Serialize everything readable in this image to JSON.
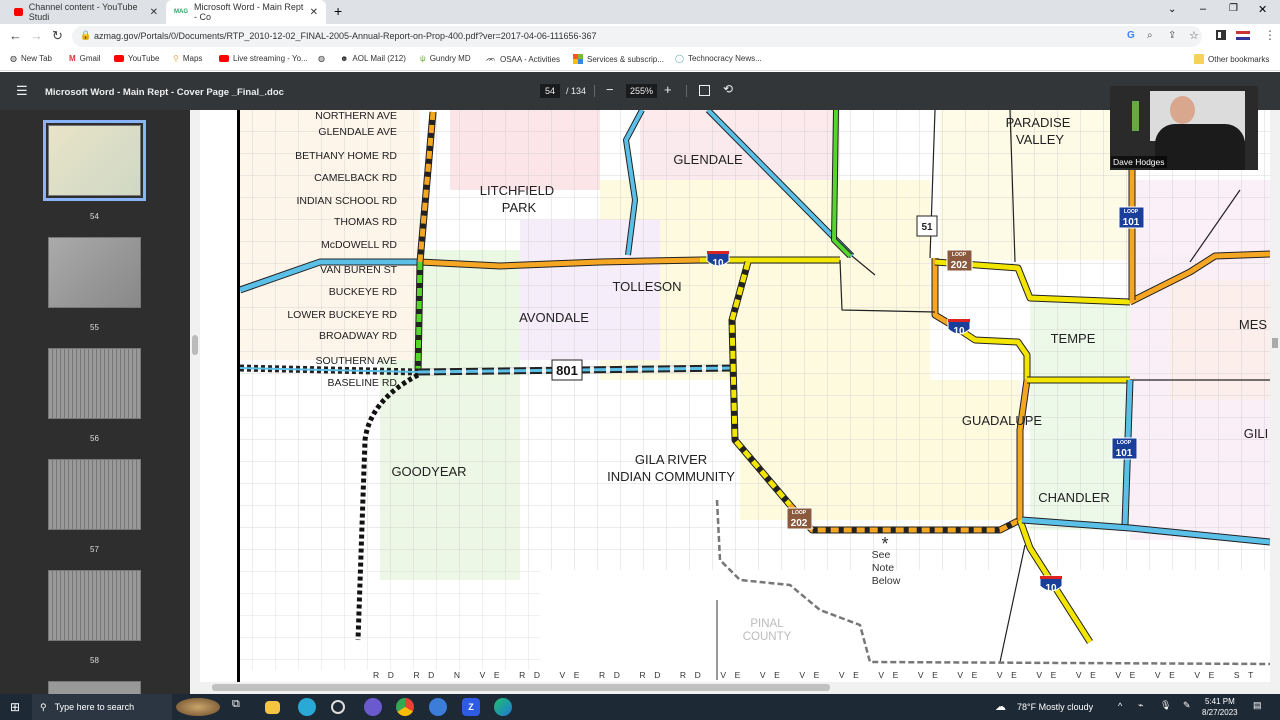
{
  "browser": {
    "tabs": [
      {
        "title": "Channel content - YouTube Studi",
        "icon": "youtube-icon"
      },
      {
        "title": "Microsoft Word - Main Rept - Co",
        "icon": "mag-icon",
        "active": true
      }
    ],
    "url": "azmag.gov/Portals/0/Documents/RTP_2010-12-02_FINAL-2005-Annual-Report-on-Prop-400.pdf?ver=2017-04-06-111656-367",
    "bookmarks": [
      "New Tab",
      "Gmail",
      "YouTube",
      "Maps",
      "Live streaming - Yo...",
      "",
      "AOL Mail (212)",
      "Gundry MD",
      "OSAA - Activities",
      "Services & subscrip...",
      "Technocracy News..."
    ],
    "other_bookmarks": "Other bookmarks"
  },
  "pdf": {
    "title": "Microsoft Word - Main Rept - Cover Page _Final_.doc",
    "page": "54",
    "total": "/ 134",
    "zoom": "255%",
    "thumbnails": [
      "54",
      "55",
      "56",
      "57",
      "58"
    ],
    "selected_page": "54"
  },
  "map": {
    "streets": [
      "NORTHERN AVE",
      "GLENDALE AVE",
      "BETHANY HOME RD",
      "CAMELBACK RD",
      "INDIAN SCHOOL RD",
      "THOMAS RD",
      "McDOWELL RD",
      "VAN BUREN ST",
      "BUCKEYE RD",
      "LOWER BUCKEYE RD",
      "BROADWAY RD",
      "SOUTHERN AVE",
      "BASELINE RD"
    ],
    "cities": {
      "paradise_valley_1": "PARADISE",
      "paradise_valley_2": "VALLEY",
      "glendale": "GLENDALE",
      "litchfield_1": "LITCHFIELD",
      "litchfield_2": "PARK",
      "tolleson": "TOLLESON",
      "avondale": "AVONDALE",
      "tempe": "TEMPE",
      "mesa": "MES",
      "guadalupe": "GUADALUPE",
      "gila_1": "GILA RIVER",
      "gila_2": "INDIAN COMMUNITY",
      "gilbert": "GILI",
      "goodyear": "GOODYEAR",
      "chandler": "CHANDLER",
      "pinal_1": "PINAL",
      "pinal_2": "COUNTY"
    },
    "shields": {
      "i10": "10",
      "sr51": "51",
      "loop101": "101",
      "loop202": "202",
      "sr801": "801",
      "loop": "LOOP"
    },
    "note": [
      "*",
      "See",
      "Note",
      "Below"
    ],
    "bottom_labels": "RD  RD  N  VE  RD  VE  RD  RD  RD  VE  VE  VE  VE  VE  VE  VE  VE  VE  VE  VE  VE  VE  ST  ST  ST  ST  ST  ST  ST  RD  RD  R  RD  RD  RD  VE  RD  RD"
  },
  "webcam": {
    "name": "Dave Hodges"
  },
  "taskbar": {
    "search": "Type here to search",
    "weather": "78°F  Mostly cloudy",
    "time": "5:41 PM",
    "date": "8/27/2023"
  },
  "colors": {
    "interstate": "#f5a623",
    "freeway_yellow": "#f2e500",
    "freeway_blue": "#5bc0e8",
    "freeway_green": "#55d62b",
    "accent": "#8ab4f8"
  }
}
